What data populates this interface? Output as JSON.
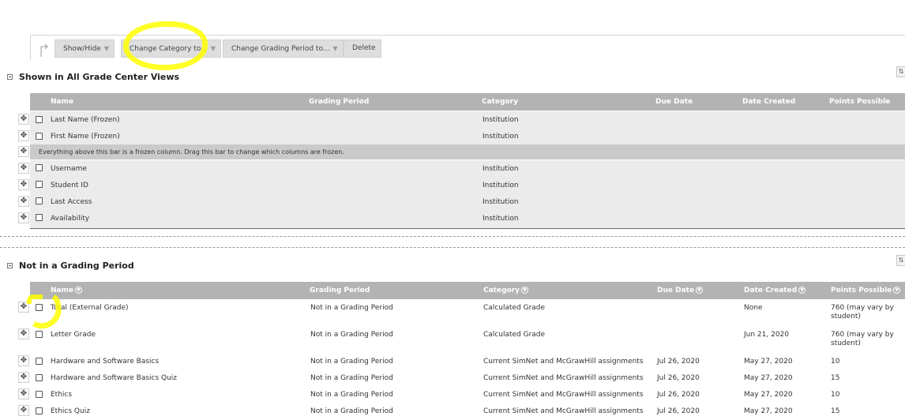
{
  "toolbar": {
    "buttons": [
      {
        "label": "Show/Hide",
        "has_menu": true
      },
      {
        "label": "Change Category to...",
        "has_menu": true
      },
      {
        "label": "Change Grading Period to...",
        "has_menu": true
      },
      {
        "label": "Delete",
        "has_menu": false
      }
    ]
  },
  "columns": [
    "Name",
    "Grading Period",
    "Category",
    "Due Date",
    "Date Created",
    "Points Possible"
  ],
  "section1": {
    "title": "Shown in All Grade Center Views",
    "frozen_rows": [
      {
        "name": "Last Name (Frozen)",
        "category": "Institution"
      },
      {
        "name": "First Name (Frozen)",
        "category": "Institution"
      }
    ],
    "frozen_message": "Everything above this bar is a frozen column. Drag this bar to change which columns are frozen.",
    "rows": [
      {
        "name": "Username",
        "category": "Institution"
      },
      {
        "name": "Student ID",
        "category": "Institution"
      },
      {
        "name": "Last Access",
        "category": "Institution"
      },
      {
        "name": "Availability",
        "category": "Institution"
      }
    ]
  },
  "section2": {
    "title": "Not in a Grading Period",
    "rows": [
      {
        "name": "Total (External Grade)",
        "period": "Not in a Grading Period",
        "category": "Calculated Grade",
        "due": "",
        "created": "None",
        "points": "760 (may vary by student)"
      },
      {
        "name": "Letter Grade",
        "period": "Not in a Grading Period",
        "category": "Calculated Grade",
        "due": "",
        "created": "Jun 21, 2020",
        "points": "760 (may vary by student)"
      },
      {
        "name": "Hardware and Software Basics",
        "period": "Not in a Grading Period",
        "category": "Current SimNet and McGrawHill assignments",
        "due": "Jul 26, 2020",
        "created": "May 27, 2020",
        "points": "10"
      },
      {
        "name": "Hardware and Software Basics Quiz",
        "period": "Not in a Grading Period",
        "category": "Current SimNet and McGrawHill assignments",
        "due": "Jul 26, 2020",
        "created": "May 27, 2020",
        "points": "15"
      },
      {
        "name": "Ethics",
        "period": "Not in a Grading Period",
        "category": "Current SimNet and McGrawHill assignments",
        "due": "Jul 26, 2020",
        "created": "May 27, 2020",
        "points": "10"
      },
      {
        "name": "Ethics Quiz",
        "period": "Not in a Grading Period",
        "category": "Current SimNet and McGrawHill assignments",
        "due": "Jul 26, 2020",
        "created": "May 27, 2020",
        "points": "15"
      }
    ]
  },
  "icons": {
    "drag": "move-arrows-icon",
    "collapse": "minus-box-icon",
    "sort": "sort-icon",
    "menu": "chevron-down-icon"
  },
  "colors": {
    "header_bg": "#b3b3b3",
    "frozen_bar": "#cacaca",
    "row_gray": "#ebebeb",
    "highlight": "#ffff00"
  }
}
